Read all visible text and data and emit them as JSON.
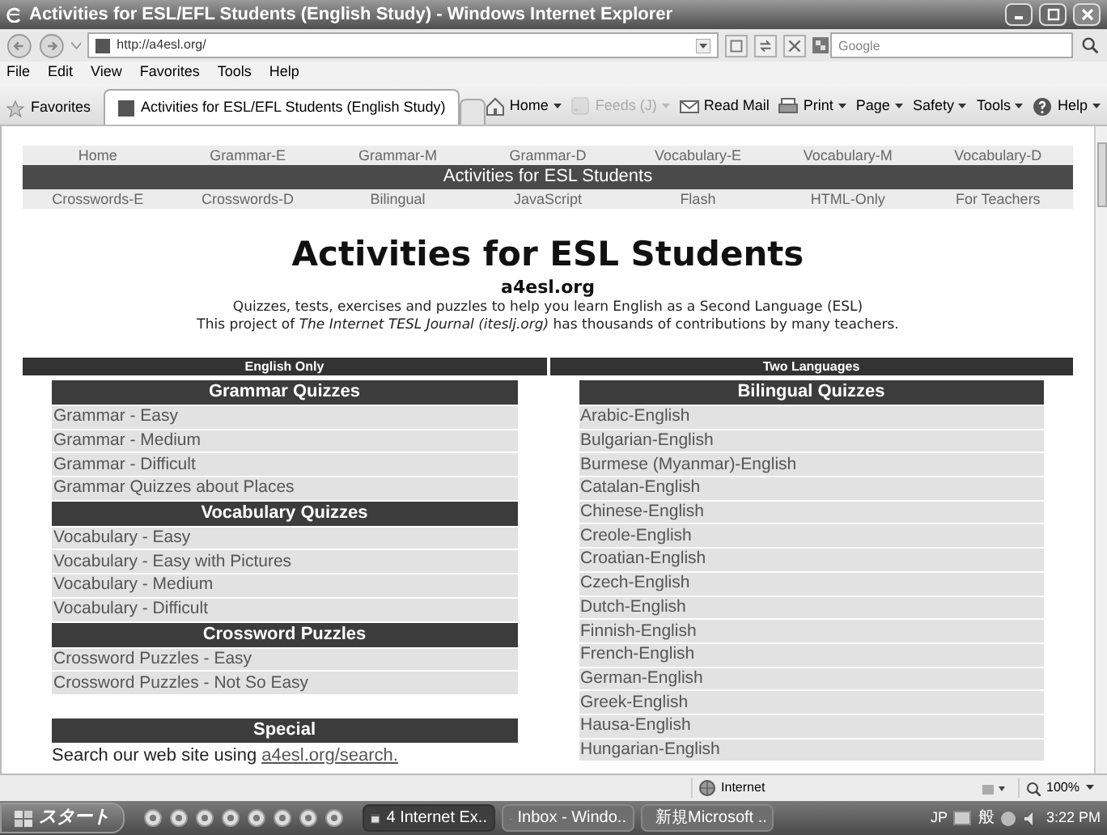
{
  "window": {
    "title": "Activities for ESL/EFL Students (English Study) - Windows Internet Explorer"
  },
  "address_bar": {
    "url": "http://a4esl.org/"
  },
  "search": {
    "placeholder": "Google"
  },
  "menu": [
    "File",
    "Edit",
    "View",
    "Favorites",
    "Tools",
    "Help"
  ],
  "favorites": "Favorites",
  "tabs": [
    {
      "label": "Activities for ESL/EFL Students (English Study)",
      "selected": true
    }
  ],
  "command_bar": [
    {
      "label": "Home",
      "dropdown": true,
      "disabled": false
    },
    {
      "label": "Feeds (J)",
      "dropdown": true,
      "disabled": true
    },
    {
      "label": "Read Mail",
      "dropdown": false,
      "disabled": false
    },
    {
      "label": "Print",
      "dropdown": true,
      "disabled": false
    },
    {
      "label": "Page",
      "dropdown": true,
      "disabled": false
    },
    {
      "label": "Safety",
      "dropdown": true,
      "disabled": false
    },
    {
      "label": "Tools",
      "dropdown": true,
      "disabled": false
    },
    {
      "label": "Help",
      "dropdown": true,
      "disabled": false
    }
  ],
  "page": {
    "nav_top": [
      "Home",
      "Grammar-E",
      "Grammar-M",
      "Grammar-D",
      "Vocabulary-E",
      "Vocabulary-M",
      "Vocabulary-D"
    ],
    "banner": "Activities for ESL Students",
    "nav_bottom": [
      "Crosswords-E",
      "Crosswords-D",
      "Bilingual",
      "JavaScript",
      "Flash",
      "HTML-Only",
      "For Teachers"
    ],
    "heading": "Activities for ESL Students",
    "site": "a4esl.org",
    "description": [
      "Quizzes, tests, exercises and puzzles to help you learn English as a Second Language (ESL)",
      "This project of *The Internet TESL Journal (iteslj.org)* has thousands of contributions by many teachers."
    ],
    "columns": [
      {
        "header": "English Only",
        "sections": [
          {
            "title": "Grammar Quizzes",
            "items": [
              "Grammar - Easy",
              "Grammar - Medium",
              "Grammar - Difficult",
              "Grammar Quizzes about Places"
            ]
          },
          {
            "title": "Vocabulary Quizzes",
            "items": [
              "Vocabulary - Easy",
              "Vocabulary - Easy with Pictures",
              "Vocabulary - Medium",
              "Vocabulary - Difficult"
            ]
          },
          {
            "title": "Crossword Puzzles",
            "items": [
              "Crossword Puzzles - Easy",
              "Crossword Puzzles - Not So Easy"
            ]
          }
        ],
        "special": {
          "title": "Special",
          "text": "Search our web site using",
          "link": "a4esl.org/search."
        }
      },
      {
        "header": "Two Languages",
        "sections": [
          {
            "title": "Bilingual Quizzes",
            "items": [
              "Arabic-English",
              "Bulgarian-English",
              "Burmese (Myanmar)-English",
              "Catalan-English",
              "Chinese-English",
              "Creole-English",
              "Croatian-English",
              "Czech-English",
              "Dutch-English",
              "Finnish-English",
              "French-English",
              "German-English",
              "Greek-English",
              "Hausa-English",
              "Hungarian-English"
            ]
          }
        ]
      }
    ]
  },
  "status_bar": {
    "zone": "Internet",
    "zoom": "100%"
  },
  "taskbar": {
    "start": "スタート",
    "tasks": [
      {
        "label": "4 Internet Ex..",
        "selected": true
      },
      {
        "label": "Inbox - Windo..",
        "selected": false
      },
      {
        "label": "新規Microsoft ..",
        "selected": false
      }
    ],
    "language": "JP",
    "ime": "般",
    "clock": "3:22 PM"
  }
}
